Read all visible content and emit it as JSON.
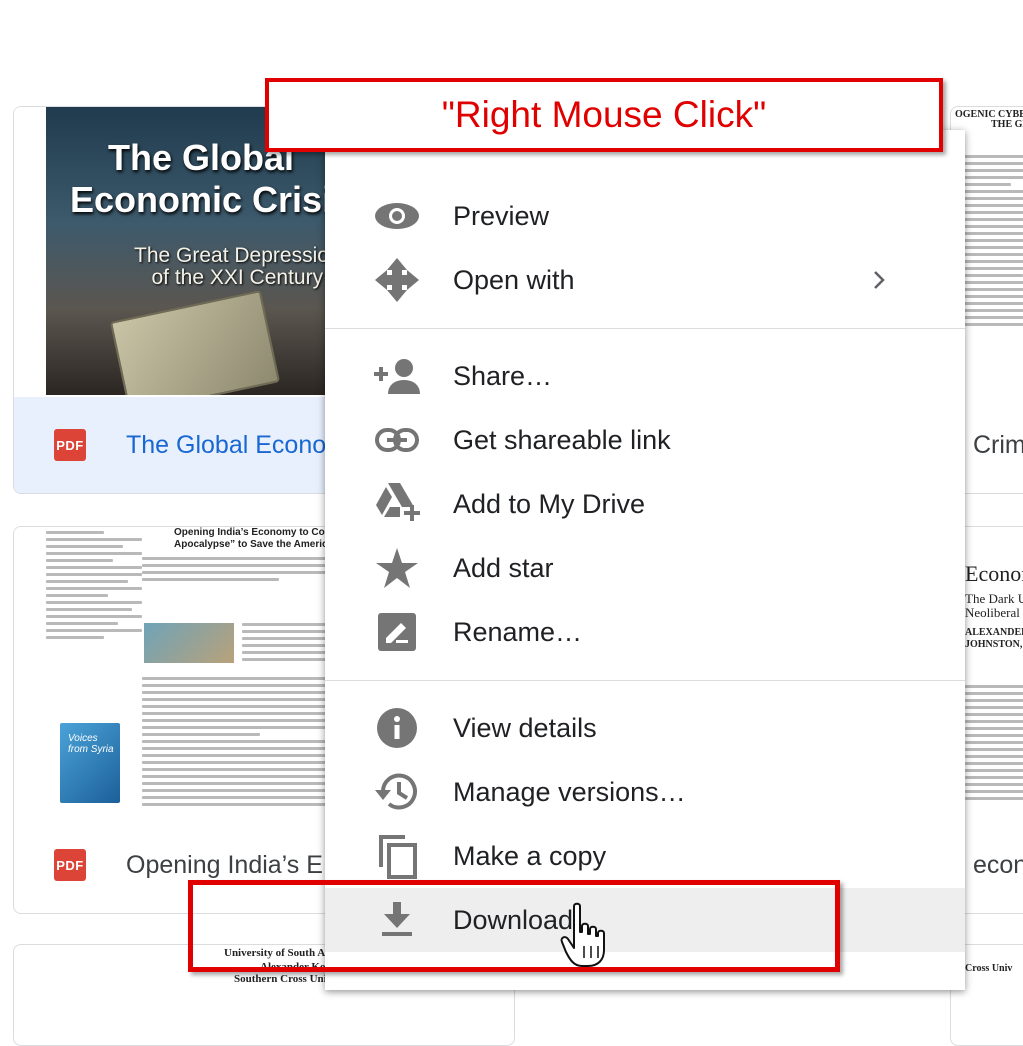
{
  "callout": {
    "text": "\"Right Mouse Click\""
  },
  "cards": [
    {
      "badge": "PDF",
      "title": "The Global Econo",
      "cover_title_line1": "The Global",
      "cover_title_line2": "Economic Crisis",
      "cover_subtitle_line1": "The Great Depression",
      "cover_subtitle_line2": "of the XXI Century"
    },
    {
      "badge": "PDF",
      "title": "Opening India’s E",
      "article_title_line1": "Opening India’s Economy to Corporate America:",
      "article_title_line2": "Apocalypse” to Save the American Dream?",
      "book_label": "Voices from Syria"
    }
  ],
  "right_cards": [
    {
      "title": "Crim",
      "paper_heading": "OGENIC CYBER-CAP",
      "paper_subheading": "THE GLO"
    },
    {
      "title": "econ",
      "paper_heading": "Econor",
      "paper_line1": "The Dark U",
      "paper_line2": "Neoliberal",
      "paper_authors1": "ALEXANDER KO",
      "paper_authors2": "JOHNSTON, AND"
    },
    {
      "paper_heading": "n Cross Univ"
    }
  ],
  "bottom_paper": {
    "line1": "University of South Aust",
    "line2": "Alexander Kom",
    "line3": "Southern Cross Unive"
  },
  "menu": {
    "items": [
      {
        "label": "Preview",
        "icon": "eye-icon"
      },
      {
        "label": "Open with",
        "icon": "move-arrows-icon",
        "submenu": true
      },
      {
        "label": "Share…",
        "icon": "person-add-icon"
      },
      {
        "label": "Get shareable link",
        "icon": "link-icon"
      },
      {
        "label": "Add to My Drive",
        "icon": "drive-add-icon"
      },
      {
        "label": "Add star",
        "icon": "star-icon"
      },
      {
        "label": "Rename…",
        "icon": "pencil-icon"
      },
      {
        "label": "View details",
        "icon": "info-icon"
      },
      {
        "label": "Manage versions…",
        "icon": "history-icon"
      },
      {
        "label": "Make a copy",
        "icon": "copy-icon"
      },
      {
        "label": "Download",
        "icon": "download-icon",
        "highlighted": true
      }
    ]
  },
  "colors": {
    "annotation_red": "#e00000",
    "selected_blue": "#1967d2",
    "pdf_red": "#db4437",
    "icon_gray": "#757575"
  }
}
